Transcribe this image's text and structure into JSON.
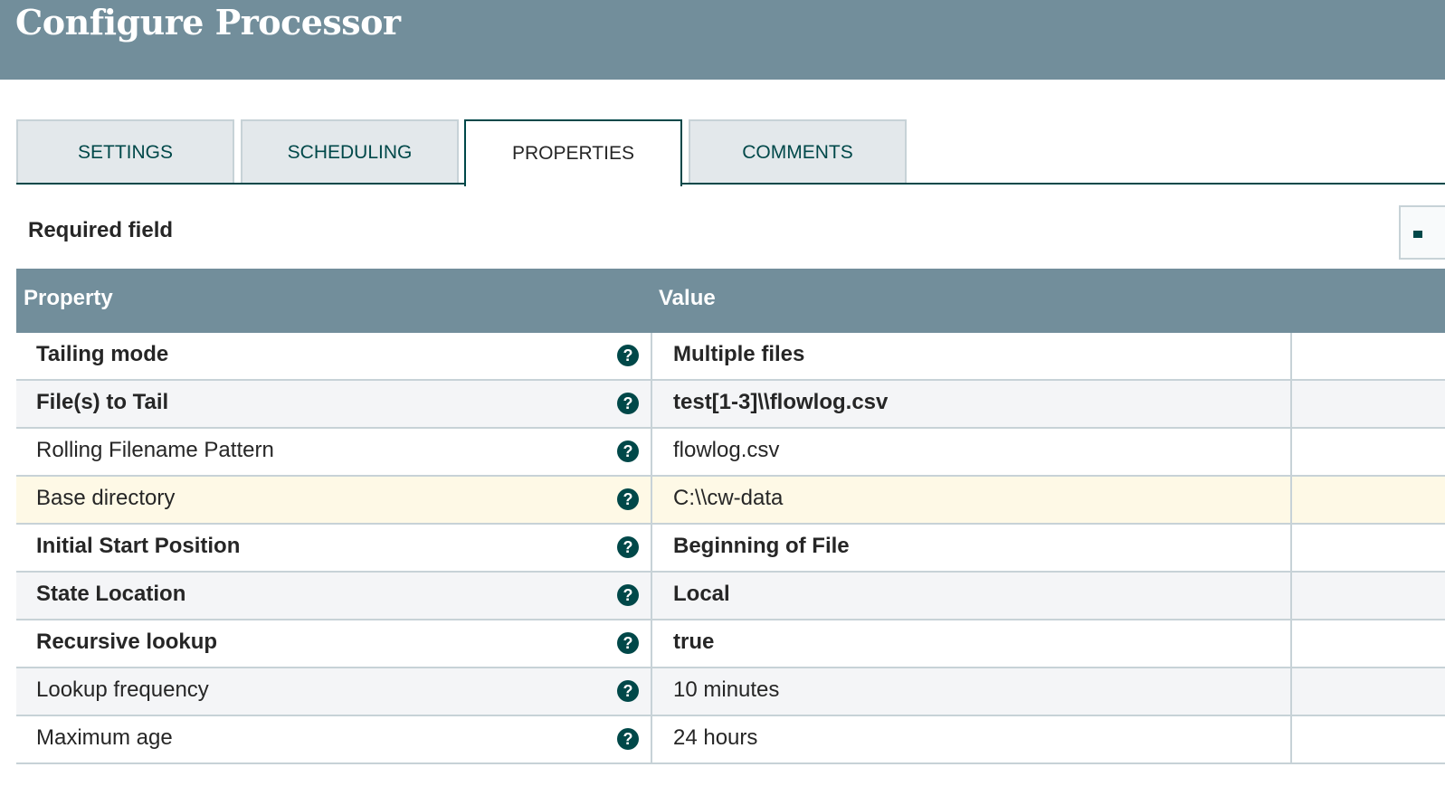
{
  "header": {
    "title": "Configure Processor"
  },
  "tabs": [
    {
      "label": "SETTINGS",
      "active": false
    },
    {
      "label": "SCHEDULING",
      "active": false
    },
    {
      "label": "PROPERTIES",
      "active": true
    },
    {
      "label": "COMMENTS",
      "active": false
    }
  ],
  "required_label": "Required field",
  "table": {
    "headers": {
      "property": "Property",
      "value": "Value"
    },
    "rows": [
      {
        "name": "Tailing mode",
        "value": "Multiple files",
        "required": true,
        "help_icon": "question-circle-icon"
      },
      {
        "name": "File(s) to Tail",
        "value": "test[1-3]\\\\flowlog.csv",
        "required": true,
        "help_icon": "question-circle-icon"
      },
      {
        "name": "Rolling Filename Pattern",
        "value": "flowlog.csv",
        "required": false,
        "help_icon": "question-circle-icon"
      },
      {
        "name": "Base directory",
        "value": "C:\\\\cw-data",
        "required": false,
        "highlighted": true,
        "help_icon": "question-circle-icon"
      },
      {
        "name": "Initial Start Position",
        "value": "Beginning of File",
        "required": true,
        "help_icon": "question-circle-icon"
      },
      {
        "name": "State Location",
        "value": "Local",
        "required": true,
        "help_icon": "question-circle-icon"
      },
      {
        "name": "Recursive lookup",
        "value": "true",
        "required": true,
        "help_icon": "question-circle-icon"
      },
      {
        "name": "Lookup frequency",
        "value": "10 minutes",
        "required": false,
        "help_icon": "question-circle-icon"
      },
      {
        "name": "Maximum age",
        "value": "24 hours",
        "required": false,
        "help_icon": "question-circle-icon"
      }
    ]
  },
  "help_glyph": "?",
  "colors": {
    "header_bg": "#728e9b",
    "accent": "#004849",
    "row_alt": "#f4f5f7",
    "row_highlight": "#fef9e6",
    "border": "#c7d2d7"
  }
}
